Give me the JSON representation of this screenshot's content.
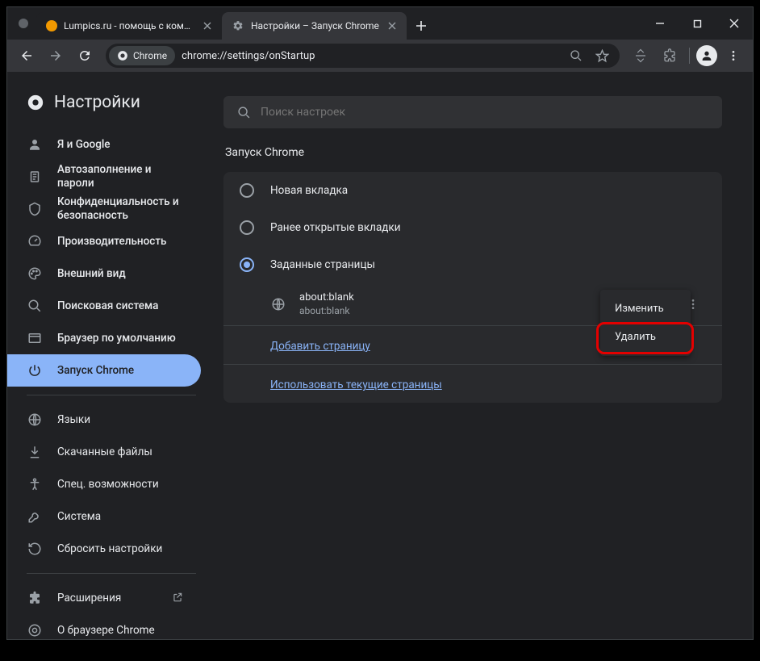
{
  "tabs": [
    {
      "title": "Lumpics.ru - помощь с компью"
    },
    {
      "title": "Настройки – Запуск Chrome"
    }
  ],
  "omnibox": {
    "chip": "Chrome",
    "url": "chrome://settings/onStartup"
  },
  "sidebar": {
    "title": "Настройки",
    "items": [
      {
        "label": "Я и Google"
      },
      {
        "label": "Автозаполнение и пароли"
      },
      {
        "label": "Конфиденциальность и безопасность"
      },
      {
        "label": "Производительность"
      },
      {
        "label": "Внешний вид"
      },
      {
        "label": "Поисковая система"
      },
      {
        "label": "Браузер по умолчанию"
      },
      {
        "label": "Запуск Chrome"
      },
      {
        "label": "Языки"
      },
      {
        "label": "Скачанные файлы"
      },
      {
        "label": "Спец. возможности"
      },
      {
        "label": "Система"
      },
      {
        "label": "Сбросить настройки"
      },
      {
        "label": "Расширения"
      },
      {
        "label": "О браузере Chrome"
      }
    ]
  },
  "main": {
    "search_placeholder": "Поиск настроек",
    "section_title": "Запуск Chrome",
    "radios": {
      "new_tab": "Новая вкладка",
      "continue": "Ранее открытые вкладки",
      "specific": "Заданные страницы"
    },
    "page": {
      "title": "about:blank",
      "url": "about:blank"
    },
    "add_page": "Добавить страницу",
    "use_current": "Использовать текущие страницы"
  },
  "context_menu": {
    "edit": "Изменить",
    "delete": "Удалить"
  }
}
